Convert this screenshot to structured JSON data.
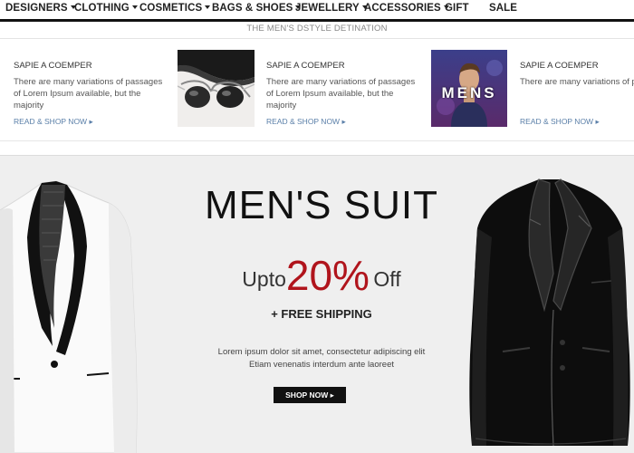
{
  "nav": {
    "items": [
      {
        "label": "DESIGNERS",
        "dropdown": true
      },
      {
        "label": "CLOTHING",
        "dropdown": true
      },
      {
        "label": "COSMETICS",
        "dropdown": true
      },
      {
        "label": "BAGS & SHOES",
        "dropdown": true
      },
      {
        "label": "JEWELLERY",
        "dropdown": true
      },
      {
        "label": "ACCESSORIES",
        "dropdown": true
      },
      {
        "label": "GIFT",
        "dropdown": false
      },
      {
        "label": "SALE",
        "dropdown": false
      }
    ]
  },
  "tagline": "THE MEN'S DSTYLE DETINATION",
  "promos": [
    {
      "title": "SAPIE A COEMPER",
      "text": "There are many variations of passages of Lorem Ipsum available, but the majority",
      "link": "READ & SHOP NOW ▸",
      "image": "none"
    },
    {
      "title": "SAPIE A COEMPER",
      "text": "There are many variations of passages of Lorem Ipsum available, but the majority",
      "link": "READ & SHOP NOW ▸",
      "image": "sunglasses-photo"
    },
    {
      "title": "SAPIE A COEMPER",
      "text": "There are many variations of passages of Lorem Ipsum available, but the majority",
      "link": "READ & SHOP NOW ▸",
      "image": "men-model-photo",
      "image_text": "MENS"
    }
  ],
  "hero": {
    "title": "MEN'S SUIT",
    "discount_prefix": "Upto",
    "discount_value": "20%",
    "discount_suffix": "Off",
    "shipping": "+ FREE SHIPPING",
    "desc_line1": "Lorem ipsum dolor sit amet, consectetur adipiscing elit",
    "desc_line2": "Etiam venenatis interdum ante laoreet",
    "cta": "SHOP NOW ▸",
    "images": [
      "white-tuxedo-jacket",
      "black-velvet-tuxedo-jacket"
    ]
  },
  "colors": {
    "accent_red": "#b0141c",
    "link_blue": "#5a7fa8",
    "hero_bg": "#efefef",
    "nav_text": "#222222"
  }
}
